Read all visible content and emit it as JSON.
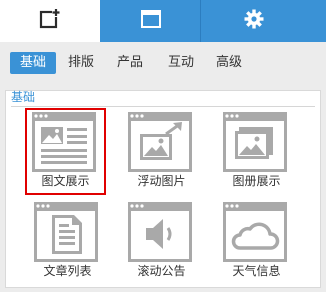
{
  "top_tabs": [
    {
      "icon": "add-component-icon",
      "active": true
    },
    {
      "icon": "window-icon",
      "active": false
    },
    {
      "icon": "gear-icon",
      "active": false
    }
  ],
  "sub_tabs": [
    "基础",
    "排版",
    "产品",
    "互动",
    "高级"
  ],
  "active_sub_tab": "基础",
  "section_title": "基础",
  "tiles": [
    {
      "label": "图文展示",
      "icon": "image-text-icon",
      "selected": true
    },
    {
      "label": "浮动图片",
      "icon": "floating-image-icon",
      "selected": false
    },
    {
      "label": "图册展示",
      "icon": "album-icon",
      "selected": false
    },
    {
      "label": "文章列表",
      "icon": "article-list-icon",
      "selected": false
    },
    {
      "label": "滚动公告",
      "icon": "speaker-icon",
      "selected": false
    },
    {
      "label": "天气信息",
      "icon": "weather-cloud-icon",
      "selected": false
    }
  ],
  "colors": {
    "accent": "#3a92d6",
    "selected_border": "#e00000",
    "icon_gray": "#a9a9a9"
  }
}
